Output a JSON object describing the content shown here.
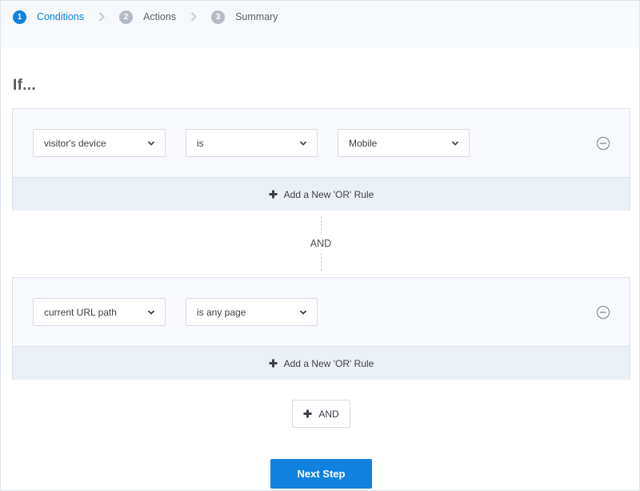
{
  "steps": [
    {
      "number": "1",
      "label": "Conditions",
      "active": true
    },
    {
      "number": "2",
      "label": "Actions",
      "active": false
    },
    {
      "number": "3",
      "label": "Summary",
      "active": false
    }
  ],
  "heading": "If...",
  "groups": [
    {
      "rule": {
        "field": "visitor's device",
        "operator": "is",
        "value": "Mobile"
      },
      "add_or_label": "Add a New 'OR' Rule"
    },
    {
      "rule": {
        "field": "current URL path",
        "operator": "is any page"
      },
      "add_or_label": "Add a New 'OR' Rule"
    }
  ],
  "and_connector_label": "AND",
  "add_and_label": "AND",
  "next_step_label": "Next Step",
  "colors": {
    "accent": "#1081de",
    "inactive_step": "#b6bcc6",
    "panel_bg": "#f8f9fc",
    "or_bar_bg": "#ebeff6"
  },
  "icons": {
    "step_separator": "chevron-right-icon",
    "select_arrow": "chevron-down-icon",
    "remove": "minus-circle-icon",
    "add": "plus-icon"
  }
}
